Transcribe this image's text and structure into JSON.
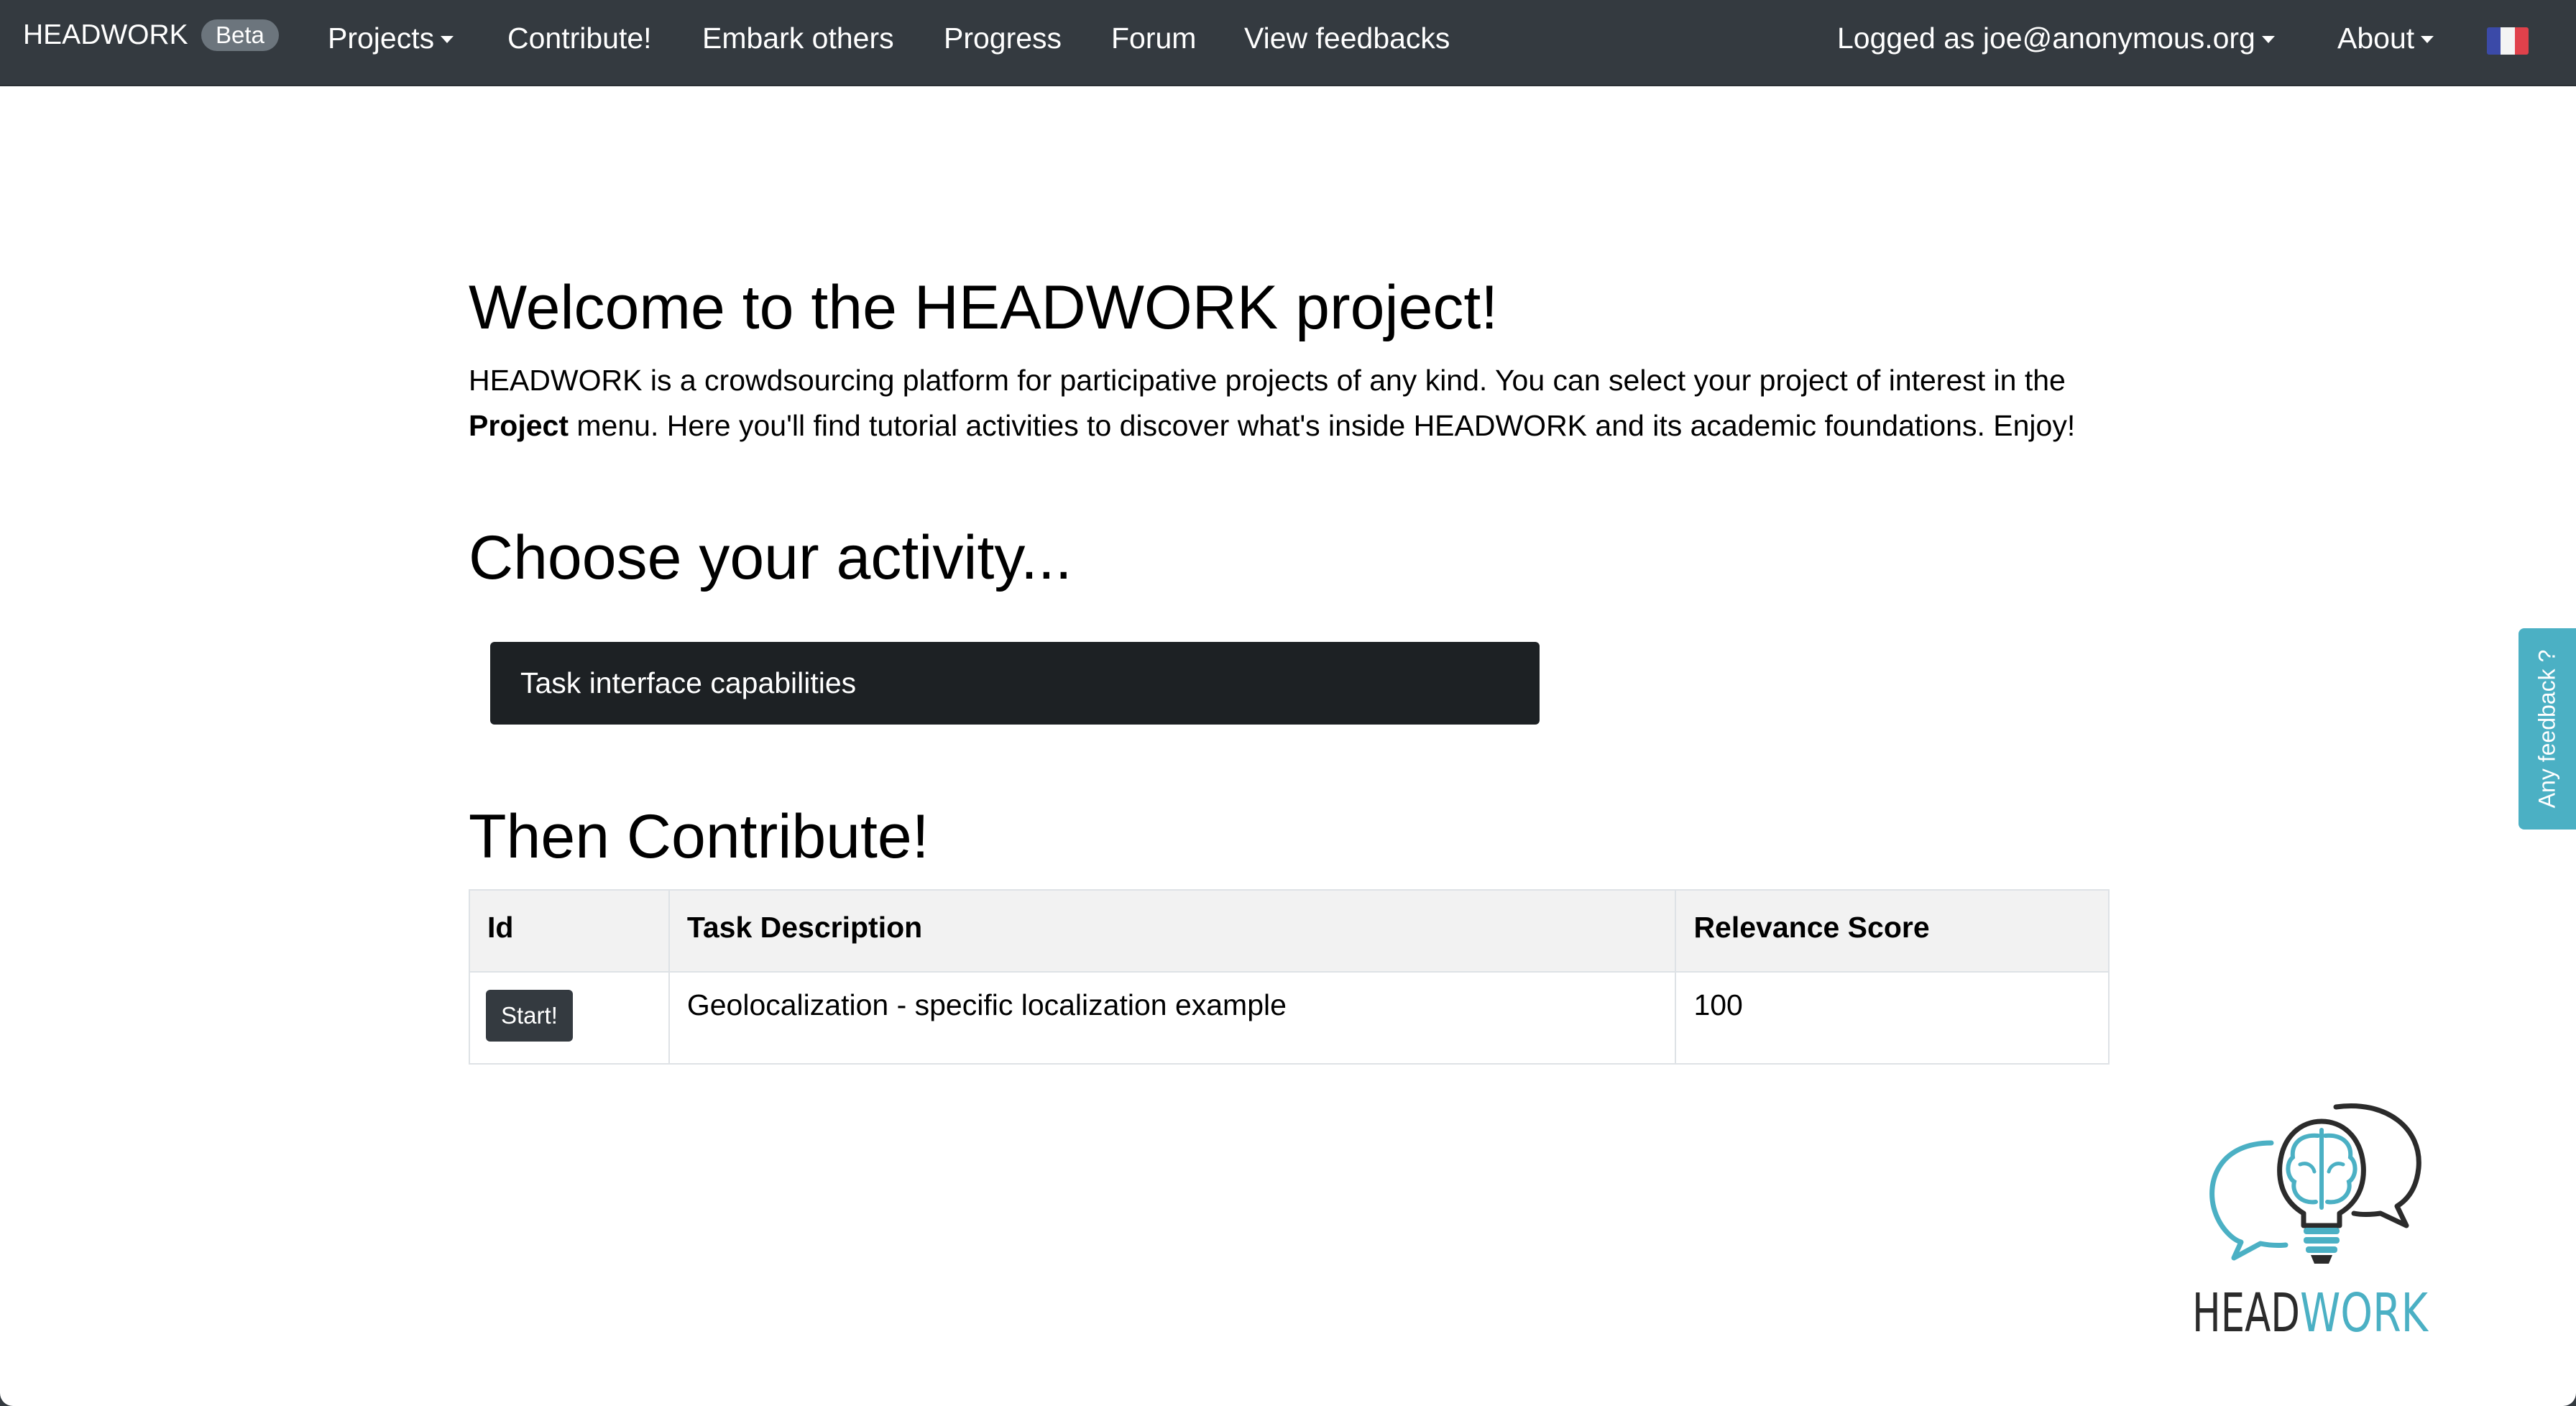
{
  "navbar": {
    "brand": "HEADWORK",
    "badge": "Beta",
    "items": [
      {
        "label": "Projects",
        "dropdown": true
      },
      {
        "label": "Contribute!",
        "dropdown": false
      },
      {
        "label": "Embark others",
        "dropdown": false
      },
      {
        "label": "Progress",
        "dropdown": false
      },
      {
        "label": "Forum",
        "dropdown": false
      },
      {
        "label": "View feedbacks",
        "dropdown": false
      }
    ],
    "user_menu": "Logged as joe@anonymous.org",
    "about": "About",
    "language_flag": "fr-flag-icon"
  },
  "main": {
    "title": "Welcome to the HEADWORK project!",
    "intro_part1": "HEADWORK is a crowdsourcing platform for participative projects of any kind. You can select your project of interest in the ",
    "intro_bold": "Project",
    "intro_part2": " menu. Here you'll find tutorial activities to discover what's inside HEADWORK and its academic foundations. Enjoy!",
    "activity_heading": "Choose your activity...",
    "activity_button": "Task interface capabilities",
    "contribute_heading": "Then Contribute!",
    "table": {
      "headers": [
        "Id",
        "Task Description",
        "Relevance Score"
      ],
      "rows": [
        {
          "action": "Start!",
          "description": "Geolocalization - specific localization example",
          "score": "100"
        }
      ]
    }
  },
  "feedback_tab": "Any feedback ?",
  "logo": {
    "text_dark": "HEAD",
    "text_accent": "WORK",
    "icon": "lightbulb-brain-chat-icon"
  },
  "colors": {
    "navbar": "#343a40",
    "badge": "#6c757d",
    "accent": "#4bb0c4",
    "activity_button": "#1d2124",
    "table_header": "#f2f2f2"
  }
}
